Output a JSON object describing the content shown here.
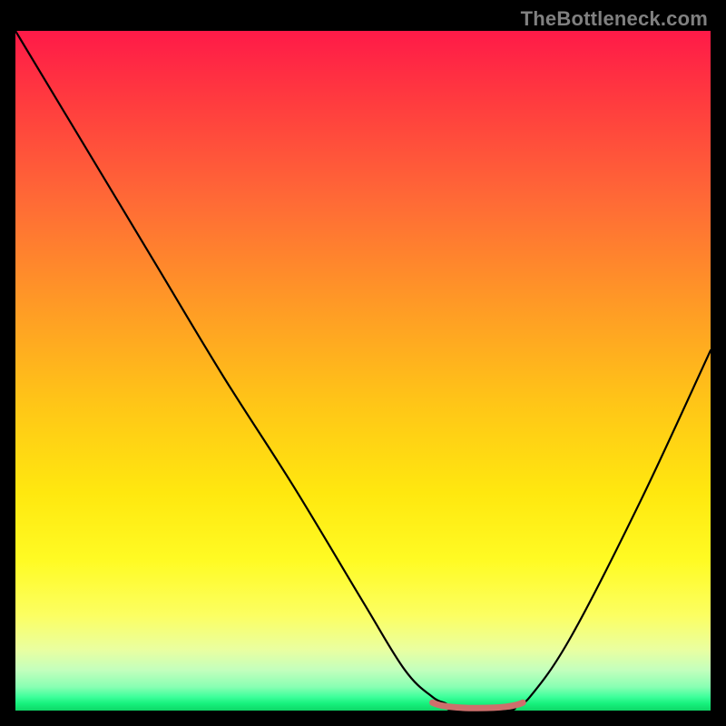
{
  "watermark": "TheBottleneck.com",
  "colors": {
    "frame": "#000000",
    "gradient_top": "#ff1a48",
    "gradient_mid": "#ffe80f",
    "gradient_bottom": "#0fd767",
    "curve": "#000000",
    "flat_segment": "#ce6f6c"
  },
  "chart_data": {
    "type": "line",
    "title": "",
    "xlabel": "",
    "ylabel": "",
    "xlim": [
      0,
      100
    ],
    "ylim": [
      0,
      100
    ],
    "series": [
      {
        "name": "bottleneck-curve",
        "x": [
          0,
          10,
          20,
          30,
          40,
          50,
          56,
          60,
          62,
          63,
          71,
          72,
          74,
          80,
          90,
          100
        ],
        "y": [
          100,
          83,
          66,
          49,
          33,
          16,
          6,
          2,
          1,
          0,
          0,
          1,
          2,
          11,
          31,
          53
        ]
      }
    ],
    "annotations": [
      {
        "name": "flat-min-segment",
        "x_range": [
          60,
          73
        ],
        "y": 0.5,
        "color": "#ce6f6c"
      }
    ]
  }
}
